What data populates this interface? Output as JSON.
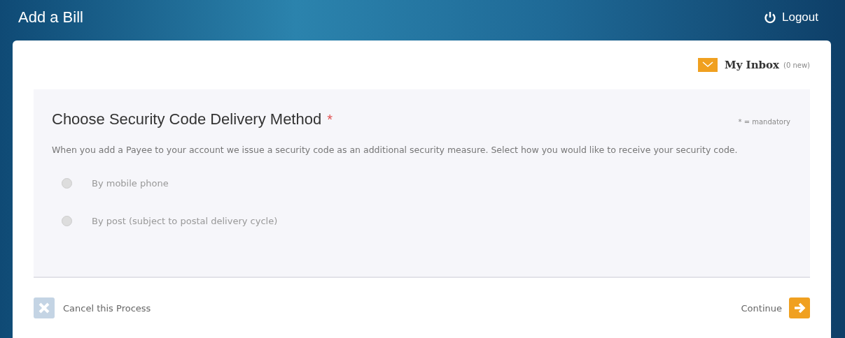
{
  "header": {
    "title": "Add a Bill",
    "logout": "Logout"
  },
  "inbox": {
    "label": "My Inbox",
    "count": "(0 new)"
  },
  "panel": {
    "title": "Choose Security Code Delivery Method",
    "required_mark": "*",
    "mandatory_note": "* = mandatory",
    "description": "When you add a Payee to your account we issue a security code as an additional security measure. Select how you would like to receive your security code.",
    "options": [
      {
        "label": "By mobile phone",
        "selected": false
      },
      {
        "label": "By post (subject to postal delivery cycle)",
        "selected": false
      }
    ]
  },
  "footer": {
    "cancel": "Cancel this Process",
    "continue": "Continue"
  }
}
